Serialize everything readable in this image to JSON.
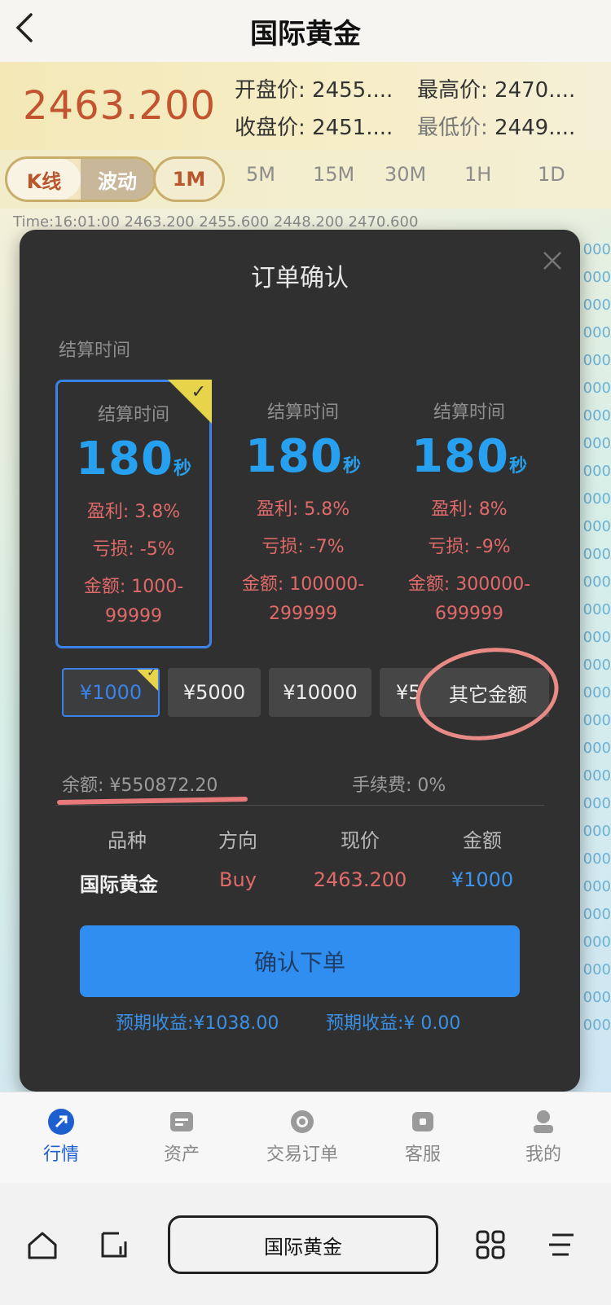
{
  "header": {
    "title": "国际黄金",
    "back_icon": "chevron-left-icon"
  },
  "quote": {
    "price": "2463.200",
    "open_label": "开盘价:",
    "open_value": "2455....",
    "high_label": "最高价:",
    "high_value": "2470....",
    "close_label": "收盘价:",
    "close_value": "2451....",
    "low_label": "最低价:",
    "low_value": "2449....",
    "price_color": "#c2552f"
  },
  "chart_tabs": {
    "toggle": [
      "K线",
      "波动"
    ],
    "periods": [
      "1M",
      "5M",
      "15M",
      "30M",
      "1H",
      "1D"
    ],
    "active_period": "1M"
  },
  "ohlc_line": "Time:16:01:00  2463.200  2455.600  2448.200  2470.600",
  "modal": {
    "title": "订单确认",
    "section_label": "结算时间",
    "plans": [
      {
        "title": "结算时间",
        "duration": "180",
        "unit": "秒",
        "profit": "盈利: 3.8%",
        "loss": "亏损: -5%",
        "amount_line1": "金额: 1000-",
        "amount_line2": "99999",
        "selected": true
      },
      {
        "title": "结算时间",
        "duration": "180",
        "unit": "秒",
        "profit": "盈利: 5.8%",
        "loss": "亏损: -7%",
        "amount_line1": "金额: 100000-",
        "amount_line2": "299999",
        "selected": false
      },
      {
        "title": "结算时间",
        "duration": "180",
        "unit": "秒",
        "profit": "盈利: 8%",
        "loss": "亏损: -9%",
        "amount_line1": "金额: 300000-",
        "amount_line2": "699999",
        "selected": false
      }
    ],
    "amounts": [
      "¥1000",
      "¥5000",
      "¥10000",
      "¥5"
    ],
    "other_amount": "其它金额",
    "balance": "余额: ¥550872.20",
    "fee": "手续费: 0%",
    "columns": [
      "品种",
      "方向",
      "现价",
      "金额"
    ],
    "order": {
      "product": "国际黄金",
      "direction": "Buy",
      "price": "2463.200",
      "amount": "¥1000"
    },
    "confirm_label": "确认下单",
    "expected_profit_1": "预期收益:¥1038.00",
    "expected_profit_2": "预期收益:¥ 0.00",
    "accent": "#2f8ef0"
  },
  "bottom_nav": [
    {
      "label": "行情",
      "icon": "market-icon",
      "active": true
    },
    {
      "label": "资产",
      "icon": "assets-icon",
      "active": false
    },
    {
      "label": "交易订单",
      "icon": "orders-icon",
      "active": false
    },
    {
      "label": "客服",
      "icon": "service-icon",
      "active": false
    },
    {
      "label": "我的",
      "icon": "profile-icon",
      "active": false
    }
  ],
  "browser": {
    "address": "国际黄金"
  }
}
